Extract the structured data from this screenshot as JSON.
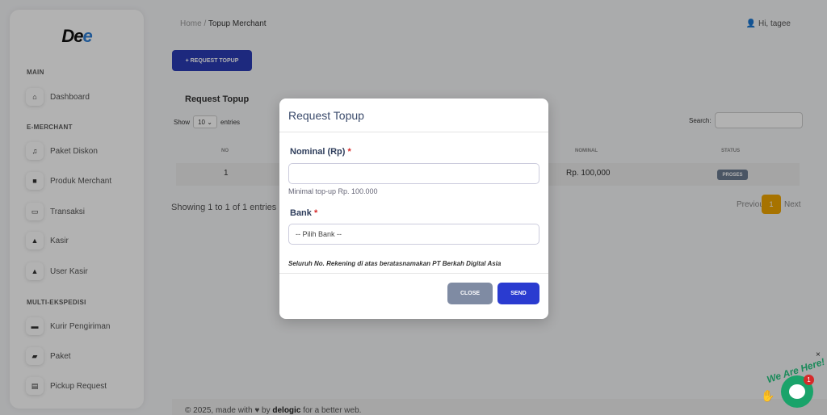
{
  "sidebar": {
    "logo_main": "De",
    "logo_accent": "e",
    "sections": [
      {
        "title": "MAIN"
      },
      {
        "title": "E-MERCHANT"
      },
      {
        "title": "MULTI-EKSPEDISI"
      }
    ],
    "items": [
      {
        "label": "Dashboard",
        "icon": "home-icon"
      },
      {
        "label": "Paket Diskon",
        "icon": "headset-icon"
      },
      {
        "label": "Produk Merchant",
        "icon": "box-icon"
      },
      {
        "label": "Transaksi",
        "icon": "basket-icon"
      },
      {
        "label": "Kasir",
        "icon": "user-icon"
      },
      {
        "label": "User Kasir",
        "icon": "user-icon"
      },
      {
        "label": "Kurir Pengiriman",
        "icon": "briefcase-icon"
      },
      {
        "label": "Paket",
        "icon": "package-icon"
      },
      {
        "label": "Pickup Request",
        "icon": "archive-icon"
      }
    ]
  },
  "header": {
    "breadcrumb_home": "Home",
    "breadcrumb_sep": "/",
    "breadcrumb_current": "Topup Merchant",
    "user_greeting": "Hi, tagee"
  },
  "main": {
    "request_button": "+ REQUEST TOPUP",
    "card_title": "Request Topup",
    "show_label": "Show",
    "entries_value": "10",
    "entries_label": "entries",
    "search_label": "Search:",
    "columns": {
      "no": "NO",
      "nominal": "NOMINAL",
      "status": "STATUS"
    },
    "row": {
      "no": "1",
      "nominal": "Rp. 100,000",
      "status": "PROSES"
    },
    "showing": "Showing 1 to 1 of 1 entries",
    "previous": "Previous",
    "page": "1",
    "next": "Next"
  },
  "footer": {
    "prefix": "© 2025, made with",
    "by": "by",
    "brand": "delogic",
    "suffix": "for a better web."
  },
  "modal": {
    "title": "Request Topup",
    "nominal_label": "Nominal (Rp)",
    "required_mark": "*",
    "nominal_value": "",
    "nominal_hint": "Minimal top-up Rp. 100.000",
    "bank_label": "Bank",
    "bank_selected": "-- Pilih Bank --",
    "note": "Seluruh No. Rekening di atas beratasnamakan PT Berkah Digital Asia",
    "close_button": "CLOSE",
    "send_button": "SEND"
  },
  "chat": {
    "tagline": "We Are Here!",
    "badge_count": "1",
    "close": "×"
  }
}
